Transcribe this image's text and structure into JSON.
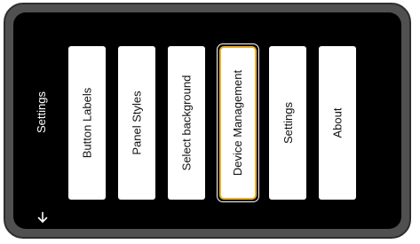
{
  "sidebar": {
    "title": "Settings",
    "back_icon": "arrow-down-icon"
  },
  "menu": {
    "items": [
      {
        "label": "Button Labels"
      },
      {
        "label": "Panel Styles"
      },
      {
        "label": "Select background"
      },
      {
        "label": "Device Management"
      },
      {
        "label": "Settings"
      },
      {
        "label": "About"
      }
    ],
    "selected": "Device Management"
  },
  "colors": {
    "screen_background": "#000000",
    "tile_background": "#ffffff",
    "selection_border": "#ecb027",
    "frame": "#505050"
  }
}
